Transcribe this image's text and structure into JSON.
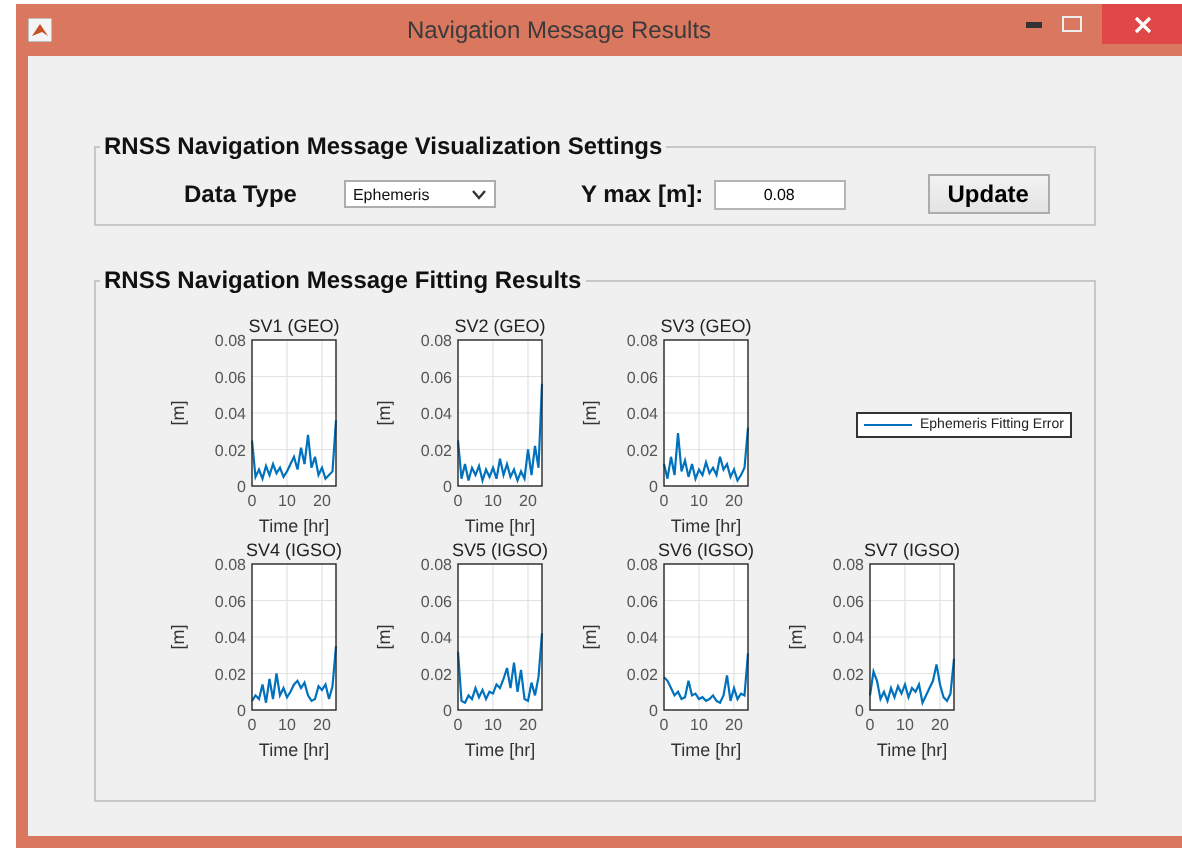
{
  "window": {
    "title": "Navigation Message Results"
  },
  "settings": {
    "title": "RNSS Navigation Message Visualization Settings",
    "data_type_label": "Data Type",
    "data_type_value": "Ephemeris",
    "ymax_label": "Y max [m]:",
    "ymax_value": "0.08",
    "button": "Update"
  },
  "results": {
    "title": "RNSS Navigation Message Fitting Results",
    "legend": {
      "label": "Ephemeris Fitting Error",
      "color": "#0072bd"
    },
    "plots": [
      {
        "chart_data": {
          "type": "line",
          "title": "SV1 (GEO)",
          "xlabel": "Time [hr]",
          "ylabel": "[m]",
          "x": [
            0,
            1,
            2,
            3,
            4,
            5,
            6,
            7,
            8,
            9,
            10,
            11,
            12,
            13,
            14,
            15,
            16,
            17,
            18,
            19,
            20,
            21,
            22,
            23,
            24
          ],
          "xlim": [
            0,
            24
          ],
          "ylim": [
            0,
            0.08
          ],
          "xticks": [
            0,
            10,
            20
          ],
          "yticks": [
            0,
            0.02,
            0.04,
            0.06,
            0.08
          ],
          "grid": true,
          "series": [
            {
              "color": "#0072bd",
              "values": [
                0.025,
                0.005,
                0.009,
                0.004,
                0.011,
                0.006,
                0.012,
                0.007,
                0.01,
                0.005,
                0.008,
                0.012,
                0.016,
                0.009,
                0.021,
                0.012,
                0.028,
                0.01,
                0.016,
                0.006,
                0.01,
                0.004,
                0.006,
                0.008,
                0.036
              ]
            }
          ]
        }
      },
      {
        "chart_data": {
          "type": "line",
          "title": "SV2 (GEO)",
          "xlabel": "Time [hr]",
          "ylabel": "[m]",
          "x": [
            0,
            1,
            2,
            3,
            4,
            5,
            6,
            7,
            8,
            9,
            10,
            11,
            12,
            13,
            14,
            15,
            16,
            17,
            18,
            19,
            20,
            21,
            22,
            23,
            24
          ],
          "xlim": [
            0,
            24
          ],
          "ylim": [
            0,
            0.08
          ],
          "xticks": [
            0,
            10,
            20
          ],
          "yticks": [
            0,
            0.02,
            0.04,
            0.06,
            0.08
          ],
          "grid": true,
          "series": [
            {
              "color": "#0072bd",
              "values": [
                0.025,
                0.004,
                0.012,
                0.003,
                0.01,
                0.006,
                0.011,
                0.003,
                0.009,
                0.005,
                0.01,
                0.004,
                0.015,
                0.006,
                0.012,
                0.005,
                0.009,
                0.003,
                0.008,
                0.004,
                0.02,
                0.006,
                0.022,
                0.01,
                0.056
              ]
            }
          ]
        }
      },
      {
        "chart_data": {
          "type": "line",
          "title": "SV3 (GEO)",
          "xlabel": "Time [hr]",
          "ylabel": "[m]",
          "x": [
            0,
            1,
            2,
            3,
            4,
            5,
            6,
            7,
            8,
            9,
            10,
            11,
            12,
            13,
            14,
            15,
            16,
            17,
            18,
            19,
            20,
            21,
            22,
            23,
            24
          ],
          "xlim": [
            0,
            24
          ],
          "ylim": [
            0,
            0.08
          ],
          "xticks": [
            0,
            10,
            20
          ],
          "yticks": [
            0,
            0.02,
            0.04,
            0.06,
            0.08
          ],
          "grid": true,
          "series": [
            {
              "color": "#0072bd",
              "values": [
                0.012,
                0.004,
                0.016,
                0.006,
                0.029,
                0.008,
                0.014,
                0.005,
                0.012,
                0.004,
                0.009,
                0.006,
                0.013,
                0.007,
                0.01,
                0.006,
                0.016,
                0.009,
                0.012,
                0.005,
                0.009,
                0.003,
                0.006,
                0.01,
                0.032
              ]
            }
          ]
        }
      },
      {
        "chart_data": {
          "type": "line",
          "title": "SV4 (IGSO)",
          "xlabel": "Time [hr]",
          "ylabel": "[m]",
          "x": [
            0,
            1,
            2,
            3,
            4,
            5,
            6,
            7,
            8,
            9,
            10,
            11,
            12,
            13,
            14,
            15,
            16,
            17,
            18,
            19,
            20,
            21,
            22,
            23,
            24
          ],
          "xlim": [
            0,
            24
          ],
          "ylim": [
            0,
            0.08
          ],
          "xticks": [
            0,
            10,
            20
          ],
          "yticks": [
            0,
            0.02,
            0.04,
            0.06,
            0.08
          ],
          "grid": true,
          "series": [
            {
              "color": "#0072bd",
              "values": [
                0.005,
                0.008,
                0.006,
                0.014,
                0.004,
                0.017,
                0.006,
                0.02,
                0.008,
                0.012,
                0.007,
                0.01,
                0.014,
                0.016,
                0.012,
                0.015,
                0.008,
                0.005,
                0.006,
                0.013,
                0.011,
                0.014,
                0.006,
                0.013,
                0.035
              ]
            }
          ]
        }
      },
      {
        "chart_data": {
          "type": "line",
          "title": "SV5 (IGSO)",
          "xlabel": "Time [hr]",
          "ylabel": "[m]",
          "x": [
            0,
            1,
            2,
            3,
            4,
            5,
            6,
            7,
            8,
            9,
            10,
            11,
            12,
            13,
            14,
            15,
            16,
            17,
            18,
            19,
            20,
            21,
            22,
            23,
            24
          ],
          "xlim": [
            0,
            24
          ],
          "ylim": [
            0,
            0.08
          ],
          "xticks": [
            0,
            10,
            20
          ],
          "yticks": [
            0,
            0.02,
            0.04,
            0.06,
            0.08
          ],
          "grid": true,
          "series": [
            {
              "color": "#0072bd",
              "values": [
                0.032,
                0.005,
                0.004,
                0.008,
                0.006,
                0.012,
                0.007,
                0.011,
                0.006,
                0.01,
                0.009,
                0.014,
                0.012,
                0.017,
                0.023,
                0.012,
                0.026,
                0.01,
                0.022,
                0.006,
                0.005,
                0.015,
                0.008,
                0.018,
                0.042
              ]
            }
          ]
        }
      },
      {
        "chart_data": {
          "type": "line",
          "title": "SV6 (IGSO)",
          "xlabel": "Time [hr]",
          "ylabel": "[m]",
          "x": [
            0,
            1,
            2,
            3,
            4,
            5,
            6,
            7,
            8,
            9,
            10,
            11,
            12,
            13,
            14,
            15,
            16,
            17,
            18,
            19,
            20,
            21,
            22,
            23,
            24
          ],
          "xlim": [
            0,
            24
          ],
          "ylim": [
            0,
            0.08
          ],
          "xticks": [
            0,
            10,
            20
          ],
          "yticks": [
            0,
            0.02,
            0.04,
            0.06,
            0.08
          ],
          "grid": true,
          "series": [
            {
              "color": "#0072bd",
              "values": [
                0.018,
                0.016,
                0.012,
                0.008,
                0.01,
                0.006,
                0.007,
                0.016,
                0.008,
                0.009,
                0.006,
                0.007,
                0.005,
                0.006,
                0.008,
                0.005,
                0.004,
                0.008,
                0.019,
                0.005,
                0.012,
                0.006,
                0.009,
                0.008,
                0.031
              ]
            }
          ]
        }
      },
      {
        "chart_data": {
          "type": "line",
          "title": "SV7 (IGSO)",
          "xlabel": "Time [hr]",
          "ylabel": "[m]",
          "x": [
            0,
            1,
            2,
            3,
            4,
            5,
            6,
            7,
            8,
            9,
            10,
            11,
            12,
            13,
            14,
            15,
            16,
            17,
            18,
            19,
            20,
            21,
            22,
            23,
            24
          ],
          "xlim": [
            0,
            24
          ],
          "ylim": [
            0,
            0.08
          ],
          "xticks": [
            0,
            10,
            20
          ],
          "yticks": [
            0,
            0.02,
            0.04,
            0.06,
            0.08
          ],
          "grid": true,
          "series": [
            {
              "color": "#0072bd",
              "values": [
                0.008,
                0.021,
                0.016,
                0.006,
                0.01,
                0.005,
                0.012,
                0.007,
                0.013,
                0.009,
                0.014,
                0.007,
                0.012,
                0.01,
                0.014,
                0.004,
                0.008,
                0.012,
                0.016,
                0.025,
                0.014,
                0.007,
                0.005,
                0.009,
                0.028
              ]
            }
          ]
        }
      }
    ]
  }
}
